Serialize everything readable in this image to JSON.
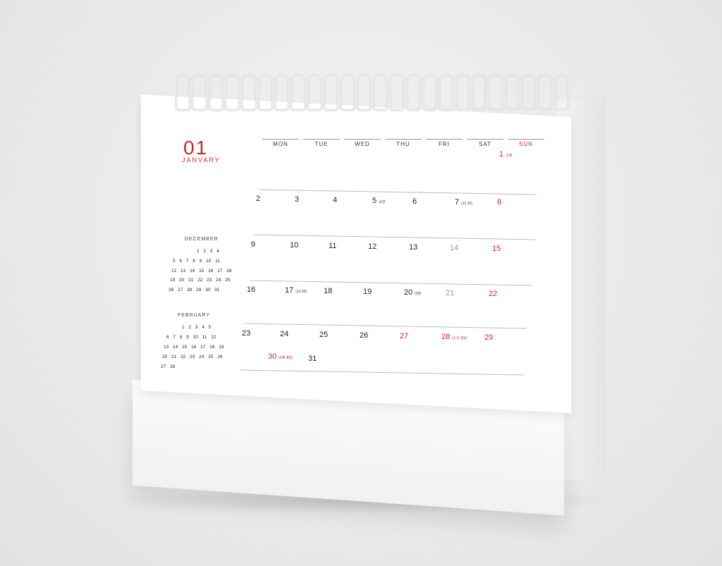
{
  "calendar": {
    "month_number": "01",
    "month_name": "JANVARY",
    "weekdays": [
      "MON",
      "TUE",
      "WED",
      "THU",
      "FRI",
      "SAT",
      "SUN"
    ],
    "days": [
      {
        "d": "1",
        "note": "신정",
        "red": true
      },
      {
        "d": "2"
      },
      {
        "d": "3"
      },
      {
        "d": "4"
      },
      {
        "d": "5",
        "note": "소한"
      },
      {
        "d": "6"
      },
      {
        "d": "7",
        "note": "(12.10)"
      },
      {
        "d": "8",
        "red": true
      },
      {
        "d": "9"
      },
      {
        "d": "10"
      },
      {
        "d": "11"
      },
      {
        "d": "12"
      },
      {
        "d": "13"
      },
      {
        "d": "14",
        "grey": true
      },
      {
        "d": "15",
        "red": true
      },
      {
        "d": "16"
      },
      {
        "d": "17",
        "note": "(12.20)"
      },
      {
        "d": "18"
      },
      {
        "d": "19"
      },
      {
        "d": "20",
        "note": "대한"
      },
      {
        "d": "21",
        "grey": true
      },
      {
        "d": "22",
        "red": true
      },
      {
        "d": "23"
      },
      {
        "d": "24"
      },
      {
        "d": "25"
      },
      {
        "d": "26"
      },
      {
        "d": "27",
        "red": true
      },
      {
        "d": "28",
        "note": "(1.1) 설날",
        "red": true
      },
      {
        "d": "29",
        "red": true
      },
      {
        "d": "30",
        "note": "대체 휴일",
        "red": true
      },
      {
        "d": "31"
      }
    ],
    "mini_december": {
      "title": "DECEMBER",
      "rows": [
        "1 2 3 4",
        "5 6 7 8 9 10 11",
        "12 13 14 15 16 17 18",
        "19 20 21 22 23 24 25",
        "26 27 28 29 30 31"
      ]
    },
    "mini_february": {
      "title": "FEBRUARY",
      "rows": [
        "1 2 3 4 5",
        "6 7 8 9 10 11 12",
        "13 14 15 16 17 18 19",
        "20 21 22 23 24 25 26",
        "27 28"
      ]
    },
    "colors": {
      "accent": "#d0281e",
      "text": "#222222",
      "muted": "#999999"
    }
  }
}
